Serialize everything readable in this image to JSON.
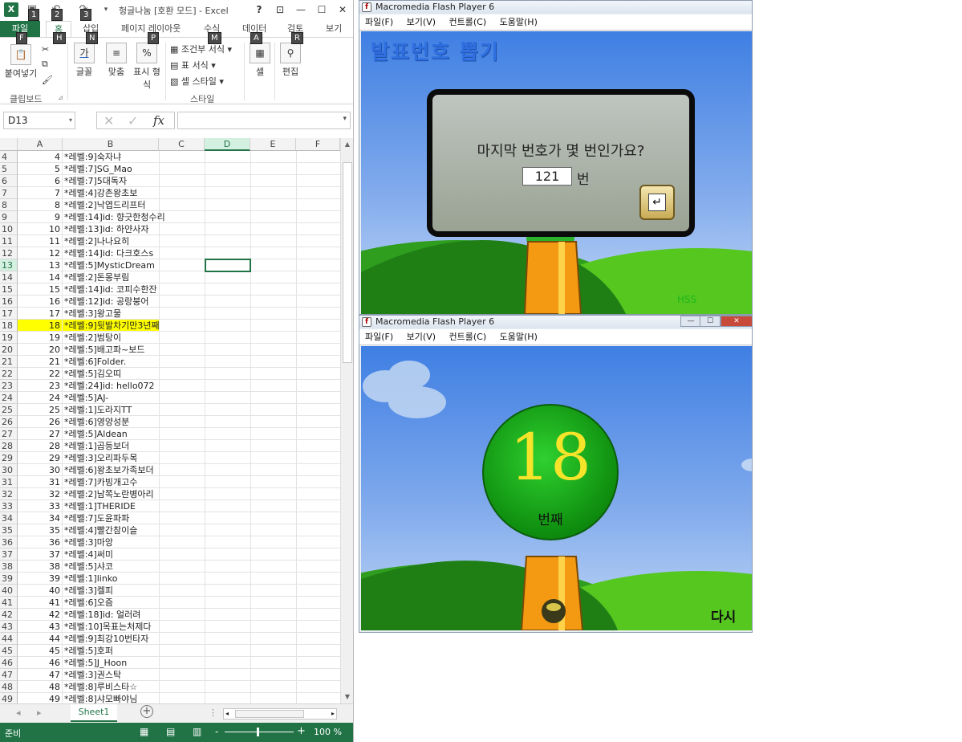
{
  "excel": {
    "title": "헝글나눔 [호환 모드] - Excel",
    "logo": "X",
    "keytips": {
      "save": "1",
      "undo": "2",
      "redo": "3",
      "file": "F",
      "home": "H",
      "insert": "N",
      "layout": "P",
      "formulas": "M",
      "data": "A",
      "review": "R"
    },
    "window_controls": {
      "help": "?",
      "ribbon_display": "⊡",
      "minimize": "—",
      "maximize": "☐",
      "close": "✕"
    },
    "tabs": [
      "파일",
      "홈",
      "삽입",
      "페이지 레이아웃",
      "수식",
      "데이터",
      "검토",
      "보기"
    ],
    "ribbon": {
      "paste_label": "붙여넣기",
      "clipboard_label": "클립보드",
      "font_label": "글꼴",
      "font_glyph": "가",
      "align_label": "맞춤",
      "number_label_1": "표시 형",
      "number_label_2": "식",
      "number_glyph": "%",
      "conditional_label": "조건부 서식",
      "table_label": "표 서식",
      "cellstyle_label": "셀 스타일",
      "style_group_label": "스타일",
      "cells_label": "셀",
      "edit_label": "편집"
    },
    "namebox": "D13",
    "fx": "fx",
    "columns": [
      "A",
      "B",
      "C",
      "D",
      "E",
      "F"
    ],
    "selected_column": "D",
    "selected_row": "13",
    "highlighted_row": "18",
    "rows": [
      [
        "4",
        "4",
        "*레벨:9]숙자냐"
      ],
      [
        "5",
        "5",
        "*레벨:7]SG_Mao"
      ],
      [
        "6",
        "6",
        "*레벨:7]5대독자"
      ],
      [
        "7",
        "7",
        "*레벨:4]강촌왕초보"
      ],
      [
        "8",
        "8",
        "*레벨:2]낙엽드리프터"
      ],
      [
        "9",
        "9",
        "*레벨:14]id: 향긋한청수리"
      ],
      [
        "10",
        "10",
        "*레벨:13]id: 하얀사자"
      ],
      [
        "11",
        "11",
        "*레벨:2]나나요히"
      ],
      [
        "12",
        "12",
        "*레벨:14]id: 다크호스s"
      ],
      [
        "13",
        "13",
        "*레벨:5]MysticDream"
      ],
      [
        "14",
        "14",
        "*레벨:2]돈몽부림"
      ],
      [
        "15",
        "15",
        "*레벨:14]id: 코피수한잔"
      ],
      [
        "16",
        "16",
        "*레벨:12]id: 공랑붕어"
      ],
      [
        "17",
        "17",
        "*레벨:3]왕고물"
      ],
      [
        "18",
        "18",
        "*레벨:9]뒷발차기만3년째"
      ],
      [
        "19",
        "19",
        "*레벨:2]범탕이"
      ],
      [
        "20",
        "20",
        "*레벨:5]배고파~보드"
      ],
      [
        "21",
        "21",
        "*레벨:6]Folder."
      ],
      [
        "22",
        "22",
        "*레벨:5]김오띠"
      ],
      [
        "23",
        "23",
        "*레벨:24]id: hello072"
      ],
      [
        "24",
        "24",
        "*레벨:5]AJ-"
      ],
      [
        "25",
        "25",
        "*레벨:1]도라지TT"
      ],
      [
        "26",
        "26",
        "*레벨:6]영양성분"
      ],
      [
        "27",
        "27",
        "*레벨:5]Aldean"
      ],
      [
        "28",
        "28",
        "*레벨:1]곱등보더"
      ],
      [
        "29",
        "29",
        "*레벨:3]오리파두목"
      ],
      [
        "30",
        "30",
        "*레벨:6]왕초보가족보더"
      ],
      [
        "31",
        "31",
        "*레벨:7]카빙개고수"
      ],
      [
        "32",
        "32",
        "*레벨:2]남쪽노란병아리"
      ],
      [
        "33",
        "33",
        "*레벨:1]THERIDE"
      ],
      [
        "34",
        "34",
        "*레벨:7]도윤파파"
      ],
      [
        "35",
        "35",
        "*레벨:4]빨간참이슬"
      ],
      [
        "36",
        "36",
        "*레벨:3]마앙"
      ],
      [
        "37",
        "37",
        "*레벨:4]써미"
      ],
      [
        "38",
        "38",
        "*레벨:5]샤코"
      ],
      [
        "39",
        "39",
        "*레벨:1]linko"
      ],
      [
        "40",
        "40",
        "*레벨:3]켈피"
      ],
      [
        "41",
        "41",
        "*레벨:6]오즘"
      ],
      [
        "42",
        "42",
        "*레벨:18]id: 얼러려"
      ],
      [
        "43",
        "43",
        "*레벨:10]목표는처제다"
      ],
      [
        "44",
        "44",
        "*레벨:9]최강10번타자"
      ],
      [
        "45",
        "45",
        "*레벨:5]호퍼"
      ],
      [
        "46",
        "46",
        "*레벨:5]J_Hoon"
      ],
      [
        "47",
        "47",
        "*레벨:3]권스탁"
      ],
      [
        "48",
        "48",
        "*레벨:8]루비스타☆"
      ],
      [
        "49",
        "49",
        "*레벨:8]샤모빠야님"
      ]
    ],
    "sheet_tab": "Sheet1",
    "add_sheet": "+",
    "status_text": "준비",
    "zoom": "100 %",
    "zoom_minus": "-",
    "zoom_plus": "+"
  },
  "flash1": {
    "title": "Macromedia Flash Player 6",
    "menu": [
      "파일(F)",
      "보기(V)",
      "컨트롤(C)",
      "도움말(H)"
    ],
    "heading": "발표번호 뽑기",
    "question": "마지막 번호가 몇 번인가요?",
    "answer": "121",
    "unit": "번",
    "enter_glyph": "↵",
    "watermark": "HSS"
  },
  "flash2": {
    "title": "Macromedia Flash Player 6",
    "menu": [
      "파일(F)",
      "보기(V)",
      "컨트롤(C)",
      "도움말(H)"
    ],
    "number": "18",
    "ball_label": "번째",
    "again": "다시"
  },
  "colors": {
    "excel_green": "#217346",
    "highlight": "#ffff00",
    "ball_number": "#f5e42a"
  }
}
